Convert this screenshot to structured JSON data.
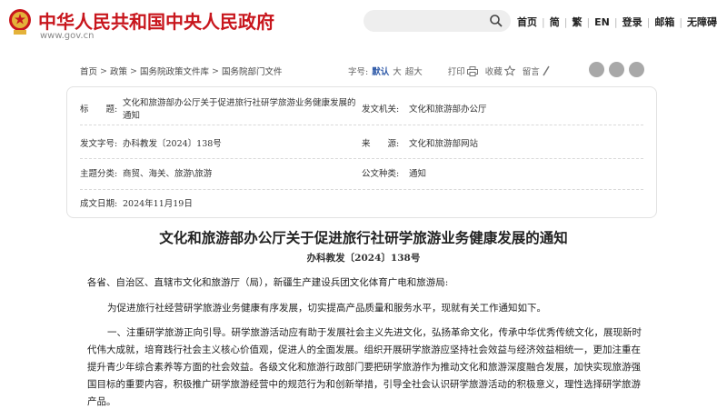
{
  "header": {
    "site_title": "中华人民共和国中央人民政府",
    "site_url": "www.gov.cn",
    "nav": [
      "首页",
      "简",
      "繁",
      "EN",
      "登录",
      "邮箱",
      "无障碍"
    ]
  },
  "breadcrumb": [
    "首页",
    "政策",
    "国务院政策文件库",
    "国务院部门文件"
  ],
  "tools": {
    "font_label": "字号:",
    "font_default": "默认",
    "font_large": "大",
    "font_xlarge": "超大",
    "print": "打印",
    "favorite": "收藏",
    "comment": "留言"
  },
  "info": {
    "title_label": "标　　题:",
    "title_value": "文化和旅游部办公厅关于促进旅行社研学旅游业务健康发展的通知",
    "issuer_label": "发文机关:",
    "issuer_value": "文化和旅游部办公厅",
    "docno_label": "发文字号:",
    "docno_value": "办科教发〔2024〕138号",
    "source_label": "来　　源:",
    "source_value": "文化和旅游部网站",
    "topic_label": "主题分类:",
    "topic_value": "商贸、海关、旅游\\旅游",
    "type_label": "公文种类:",
    "type_value": "通知",
    "date_label": "成文日期:",
    "date_value": "2024年11月19日"
  },
  "document": {
    "title": "文化和旅游部办公厅关于促进旅行社研学旅游业务健康发展的通知",
    "number": "办科教发〔2024〕138号",
    "addressee": "各省、自治区、直辖市文化和旅游厅（局），新疆生产建设兵团文化体育广电和旅游局:",
    "intro": "为促进旅行社经营研学旅游业务健康有序发展，切实提高产品质量和服务水平，现就有关工作通知如下。",
    "p1": [
      "一、注重研学旅游正向引导。研学旅游活动应有助于发展社会主义先进文化，弘扬革命文化，传承中华优秀传统文化，展现新时",
      "代伟大成就，培育践行社会主义核心价值观，促进人的全面发展。组织开展研学旅游应坚持社会效益与经济效益相统一，更加注重在",
      "提升青少年综合素养等方面的社会效益。各级文化和旅游行政部门要把研学旅游作为推动文化和旅游深度融合发展，加快实现旅游强",
      "国目标的重要内容，积极推广研学旅游经营中的规范行为和创新举措，引导全社会认识研学旅游活动的积极意义，理性选择研学旅游",
      "产品。"
    ]
  },
  "colors": {
    "brand_red": "#c8161d",
    "accent_blue": "#2f5aa8"
  }
}
